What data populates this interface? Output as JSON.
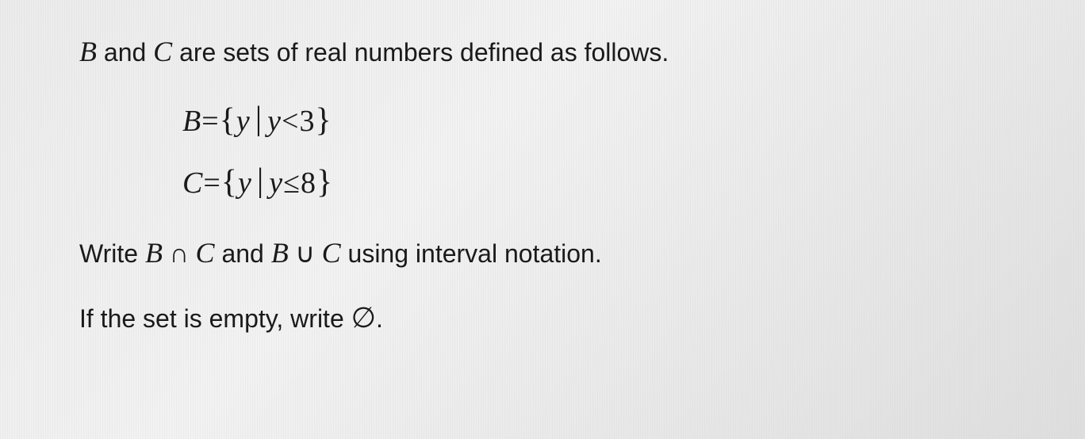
{
  "problem": {
    "intro": {
      "var1": "B",
      "conj1": " and ",
      "var2": "C",
      "rest": " are sets of real numbers defined as follows."
    },
    "setB": {
      "lhs": "B",
      "eq": "=",
      "lbrace": "{",
      "var": "y",
      "bar": "|",
      "cond_var": "y",
      "rel": "<",
      "val": "3",
      "rbrace": "}"
    },
    "setC": {
      "lhs": "C",
      "eq": "=",
      "lbrace": "{",
      "var": "y",
      "bar": "|",
      "cond_var": "y",
      "rel": "≤",
      "val": "8",
      "rbrace": "}"
    },
    "instruction1": {
      "pre": "Write ",
      "expr1_l": "B",
      "op1": " ∩ ",
      "expr1_r": "C",
      "mid": " and ",
      "expr2_l": "B",
      "op2": " ∪ ",
      "expr2_r": "C",
      "post": " using interval notation."
    },
    "instruction2": {
      "pre": "If the set is empty, write ",
      "sym": "∅",
      "post": "."
    }
  }
}
